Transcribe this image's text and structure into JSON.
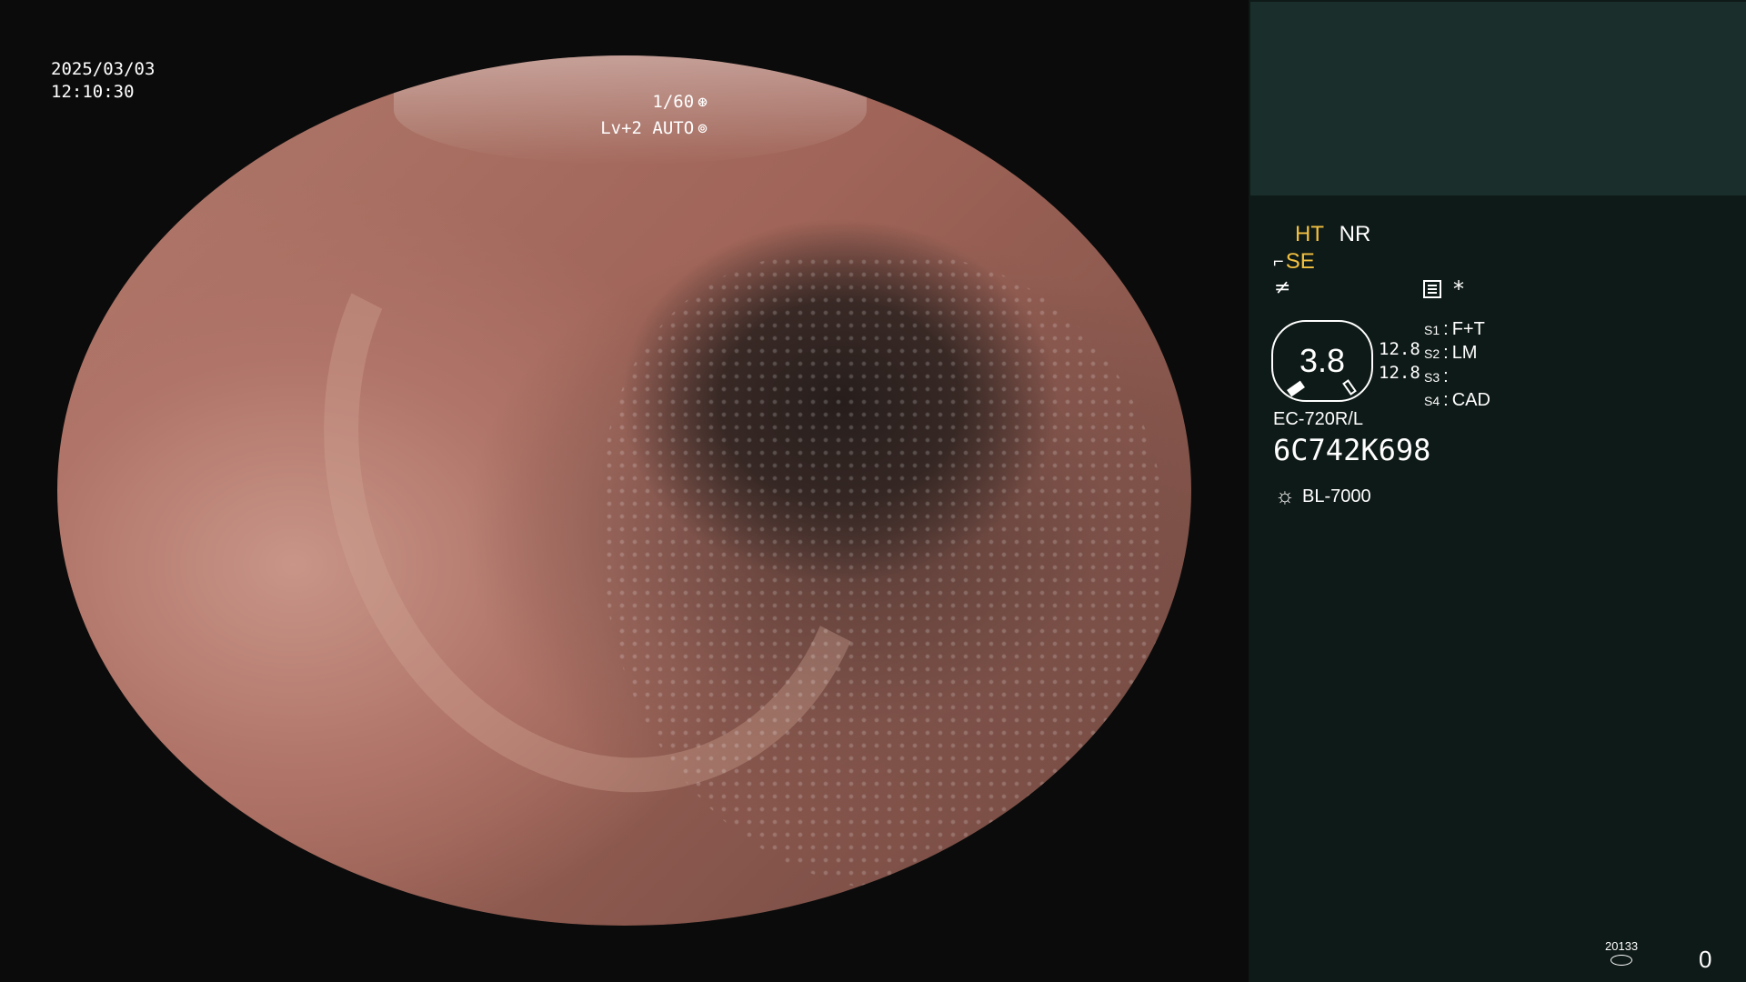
{
  "overlay": {
    "date": "2025/03/03",
    "time": "12:10:30",
    "shutter": "1/60",
    "shutter_icon": "⊛",
    "level": "Lv+2 AUTO",
    "level_icon": "⊚"
  },
  "panel": {
    "ht": "HT",
    "nr": "NR",
    "se_icon": "scope-angle-icon",
    "se": "SE",
    "f_icon": "≠",
    "star": "*",
    "gauge_value": "3.8",
    "gauge_readouts": [
      "12.8",
      "12.8"
    ],
    "switches": [
      {
        "key": "S1",
        "val": "F+T"
      },
      {
        "key": "S2",
        "val": "LM"
      },
      {
        "key": "S3",
        "val": ""
      },
      {
        "key": "S4",
        "val": "CAD"
      }
    ],
    "scope_model": "EC-720R/L",
    "serial": "6C742K698",
    "light_source": "BL-7000",
    "counter_small": "20133",
    "frame_count": "0"
  },
  "colors": {
    "accent_yellow": "#f2c041",
    "panel_bg": "#0e1a17",
    "panel_top_bg": "#1a2f2b"
  }
}
